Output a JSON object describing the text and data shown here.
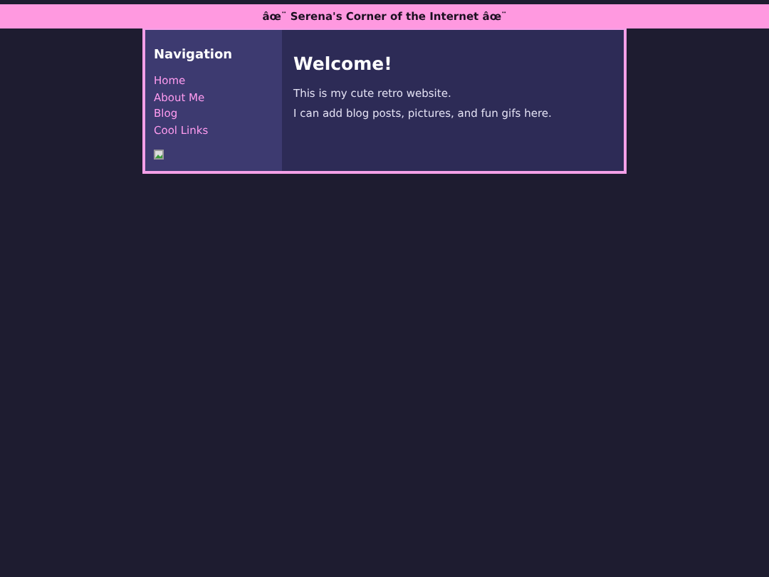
{
  "header": {
    "title": "âœ¨ Serena's Corner of the Internet âœ¨"
  },
  "sidebar": {
    "heading": "Navigation",
    "links": [
      "Home",
      "About Me",
      "Blog",
      "Cool Links"
    ],
    "broken_image": true
  },
  "main": {
    "heading": "Welcome!",
    "paragraphs": [
      "This is my cute retro website.",
      "I can add blog posts, pictures, and fun gifs here."
    ]
  }
}
